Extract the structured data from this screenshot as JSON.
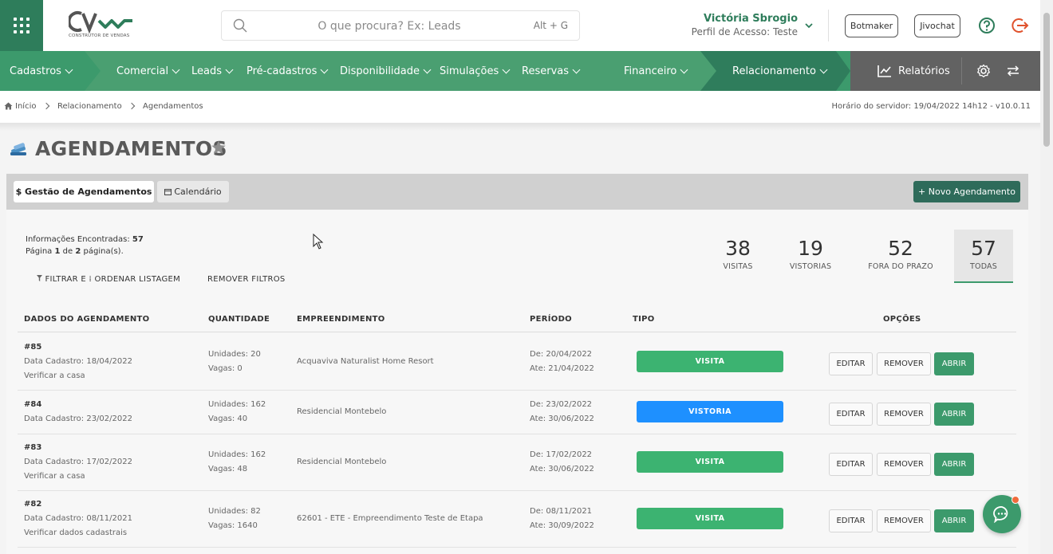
{
  "header": {
    "logo_text": "CONSTRUTOR DE VENDAS",
    "search_placeholder": "O que procura? Ex: Leads",
    "search_shortcut": "Alt + G",
    "user_name": "Victória Sbrogio",
    "user_profile": "Perfil de Acesso: Teste",
    "buttons": [
      "Botmaker",
      "Jivochat"
    ]
  },
  "nav": {
    "items": [
      "Cadastros",
      "Comercial",
      "Leads",
      "Pré-cadastros",
      "Disponibilidade",
      "Simulações",
      "Reservas",
      "Financeiro",
      "Relacionamento"
    ],
    "reports": "Relatórios"
  },
  "breadcrumb": {
    "items": [
      "Início",
      "Relacionamento",
      "Agendamentos"
    ],
    "server_time": "Horário do servidor: 19/04/2022 14h12 - v10.0.11"
  },
  "page": {
    "title": "AGENDAMENTOS",
    "tabs": [
      "$ Gestão de Agendamentos",
      "Calendário"
    ],
    "new_button": "+ Novo Agendamento"
  },
  "summary": {
    "found_label": "Informações Encontradas:",
    "found_count": "57",
    "page_prefix": "Página",
    "page_current": "1",
    "page_of": "de",
    "page_total": "2",
    "page_suffix": "página(s).",
    "filter_link": "FILTRAR E ⁞ ORDENAR LISTAGEM",
    "remove_filters": "REMOVER FILTROS"
  },
  "stats": [
    {
      "value": "38",
      "label": "VISITAS"
    },
    {
      "value": "19",
      "label": "VISTORIAS"
    },
    {
      "value": "52",
      "label": "FORA DO PRAZO"
    },
    {
      "value": "57",
      "label": "TODAS"
    }
  ],
  "table": {
    "headers": [
      "DADOS DO AGENDAMENTO",
      "QUANTIDADE",
      "EMPREENDIMENTO",
      "PERÍODO",
      "TIPO",
      "OPÇÕES"
    ],
    "options": [
      "EDITAR",
      "REMOVER",
      "ABRIR"
    ],
    "rows": [
      {
        "id": "#85",
        "date": "Data Cadastro: 18/04/2022",
        "note": "Verificar a casa",
        "units": "Unidades: 20",
        "slots": "Vagas: 0",
        "project": "Acquaviva Naturalist Home Resort",
        "from": "De: 20/04/2022",
        "to": "Ate: 21/04/2022",
        "type": "VISITA"
      },
      {
        "id": "#84",
        "date": "Data Cadastro: 23/02/2022",
        "note": "",
        "units": "Unidades: 162",
        "slots": "Vagas: 40",
        "project": "Residencial Montebelo",
        "from": "De: 23/02/2022",
        "to": "Ate: 30/06/2022",
        "type": "VISTORIA"
      },
      {
        "id": "#83",
        "date": "Data Cadastro: 17/02/2022",
        "note": "Verificar a casa",
        "units": "Unidades: 162",
        "slots": "Vagas: 48",
        "project": "Residencial Montebelo",
        "from": "De: 17/02/2022",
        "to": "Ate: 30/06/2022",
        "type": "VISITA"
      },
      {
        "id": "#82",
        "date": "Data Cadastro: 08/11/2021",
        "note": "Verificar dados cadastrais",
        "units": "Unidades: 82",
        "slots": "Vagas: 1640",
        "project": "62601 - ETE - Empreendimento Teste de Etapa",
        "from": "De: 08/11/2021",
        "to": "Ate: 30/09/2022",
        "type": "VISITA"
      }
    ]
  },
  "colors": {
    "brand": "#3c9a6c",
    "visita": "#3cb371",
    "vistoria": "#1e90ff"
  }
}
